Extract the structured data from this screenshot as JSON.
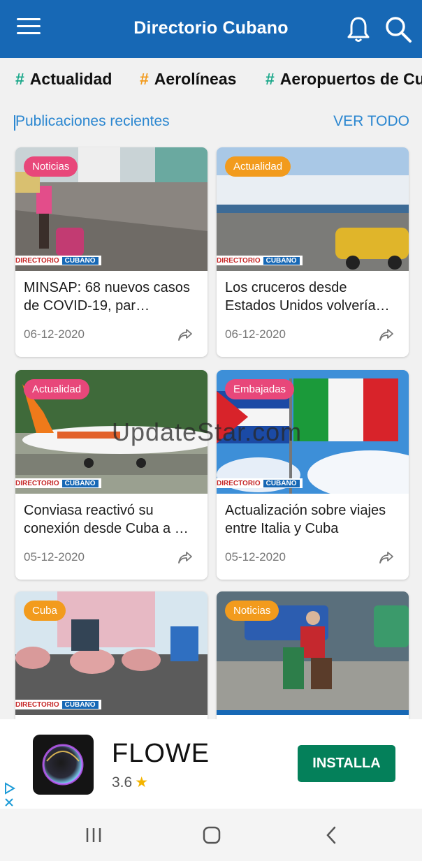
{
  "header": {
    "title": "Directorio Cubano"
  },
  "categories": [
    {
      "label": "Actualidad",
      "hash_color": "#1aa88a"
    },
    {
      "label": "Aerolíneas",
      "hash_color": "#f29b1d"
    },
    {
      "label": "Aeropuertos de Cul",
      "hash_color": "#1aa88a"
    }
  ],
  "section": {
    "title": "Publicaciones recientes",
    "more": "VER TODO"
  },
  "watermark_text": {
    "left": "DIRECTORIO",
    "right": "CUBANO"
  },
  "posts": [
    {
      "badge": "Noticias",
      "badge_color": "#e8477a",
      "title": "MINSAP: 68 nuevos casos de COVID-19, par…",
      "date": "06-12-2020"
    },
    {
      "badge": "Actualidad",
      "badge_color": "#f29b1d",
      "title": "Los cruceros desde Estados Unidos volvería…",
      "date": "06-12-2020"
    },
    {
      "badge": "Actualidad",
      "badge_color": "#e8477a",
      "title": "Conviasa reactivó su conexión desde Cuba a …",
      "date": "05-12-2020"
    },
    {
      "badge": "Embajadas",
      "badge_color": "#e8477a",
      "title": "Actualización sobre viajes entre Italia y Cuba",
      "date": "05-12-2020"
    },
    {
      "badge": "Cuba",
      "badge_color": "#f29b1d",
      "title": "",
      "date": ""
    },
    {
      "badge": "Noticias",
      "badge_color": "#f29b1d",
      "title": "",
      "date": ""
    }
  ],
  "ad": {
    "app_name": "FLOWE",
    "rating": "3.6",
    "install_label": "INSTALLA"
  },
  "overlay": {
    "site_watermark": "UpdateStar.com"
  },
  "colors": {
    "primary": "#1768b5",
    "link": "#2a86d0",
    "install": "#04805a"
  }
}
